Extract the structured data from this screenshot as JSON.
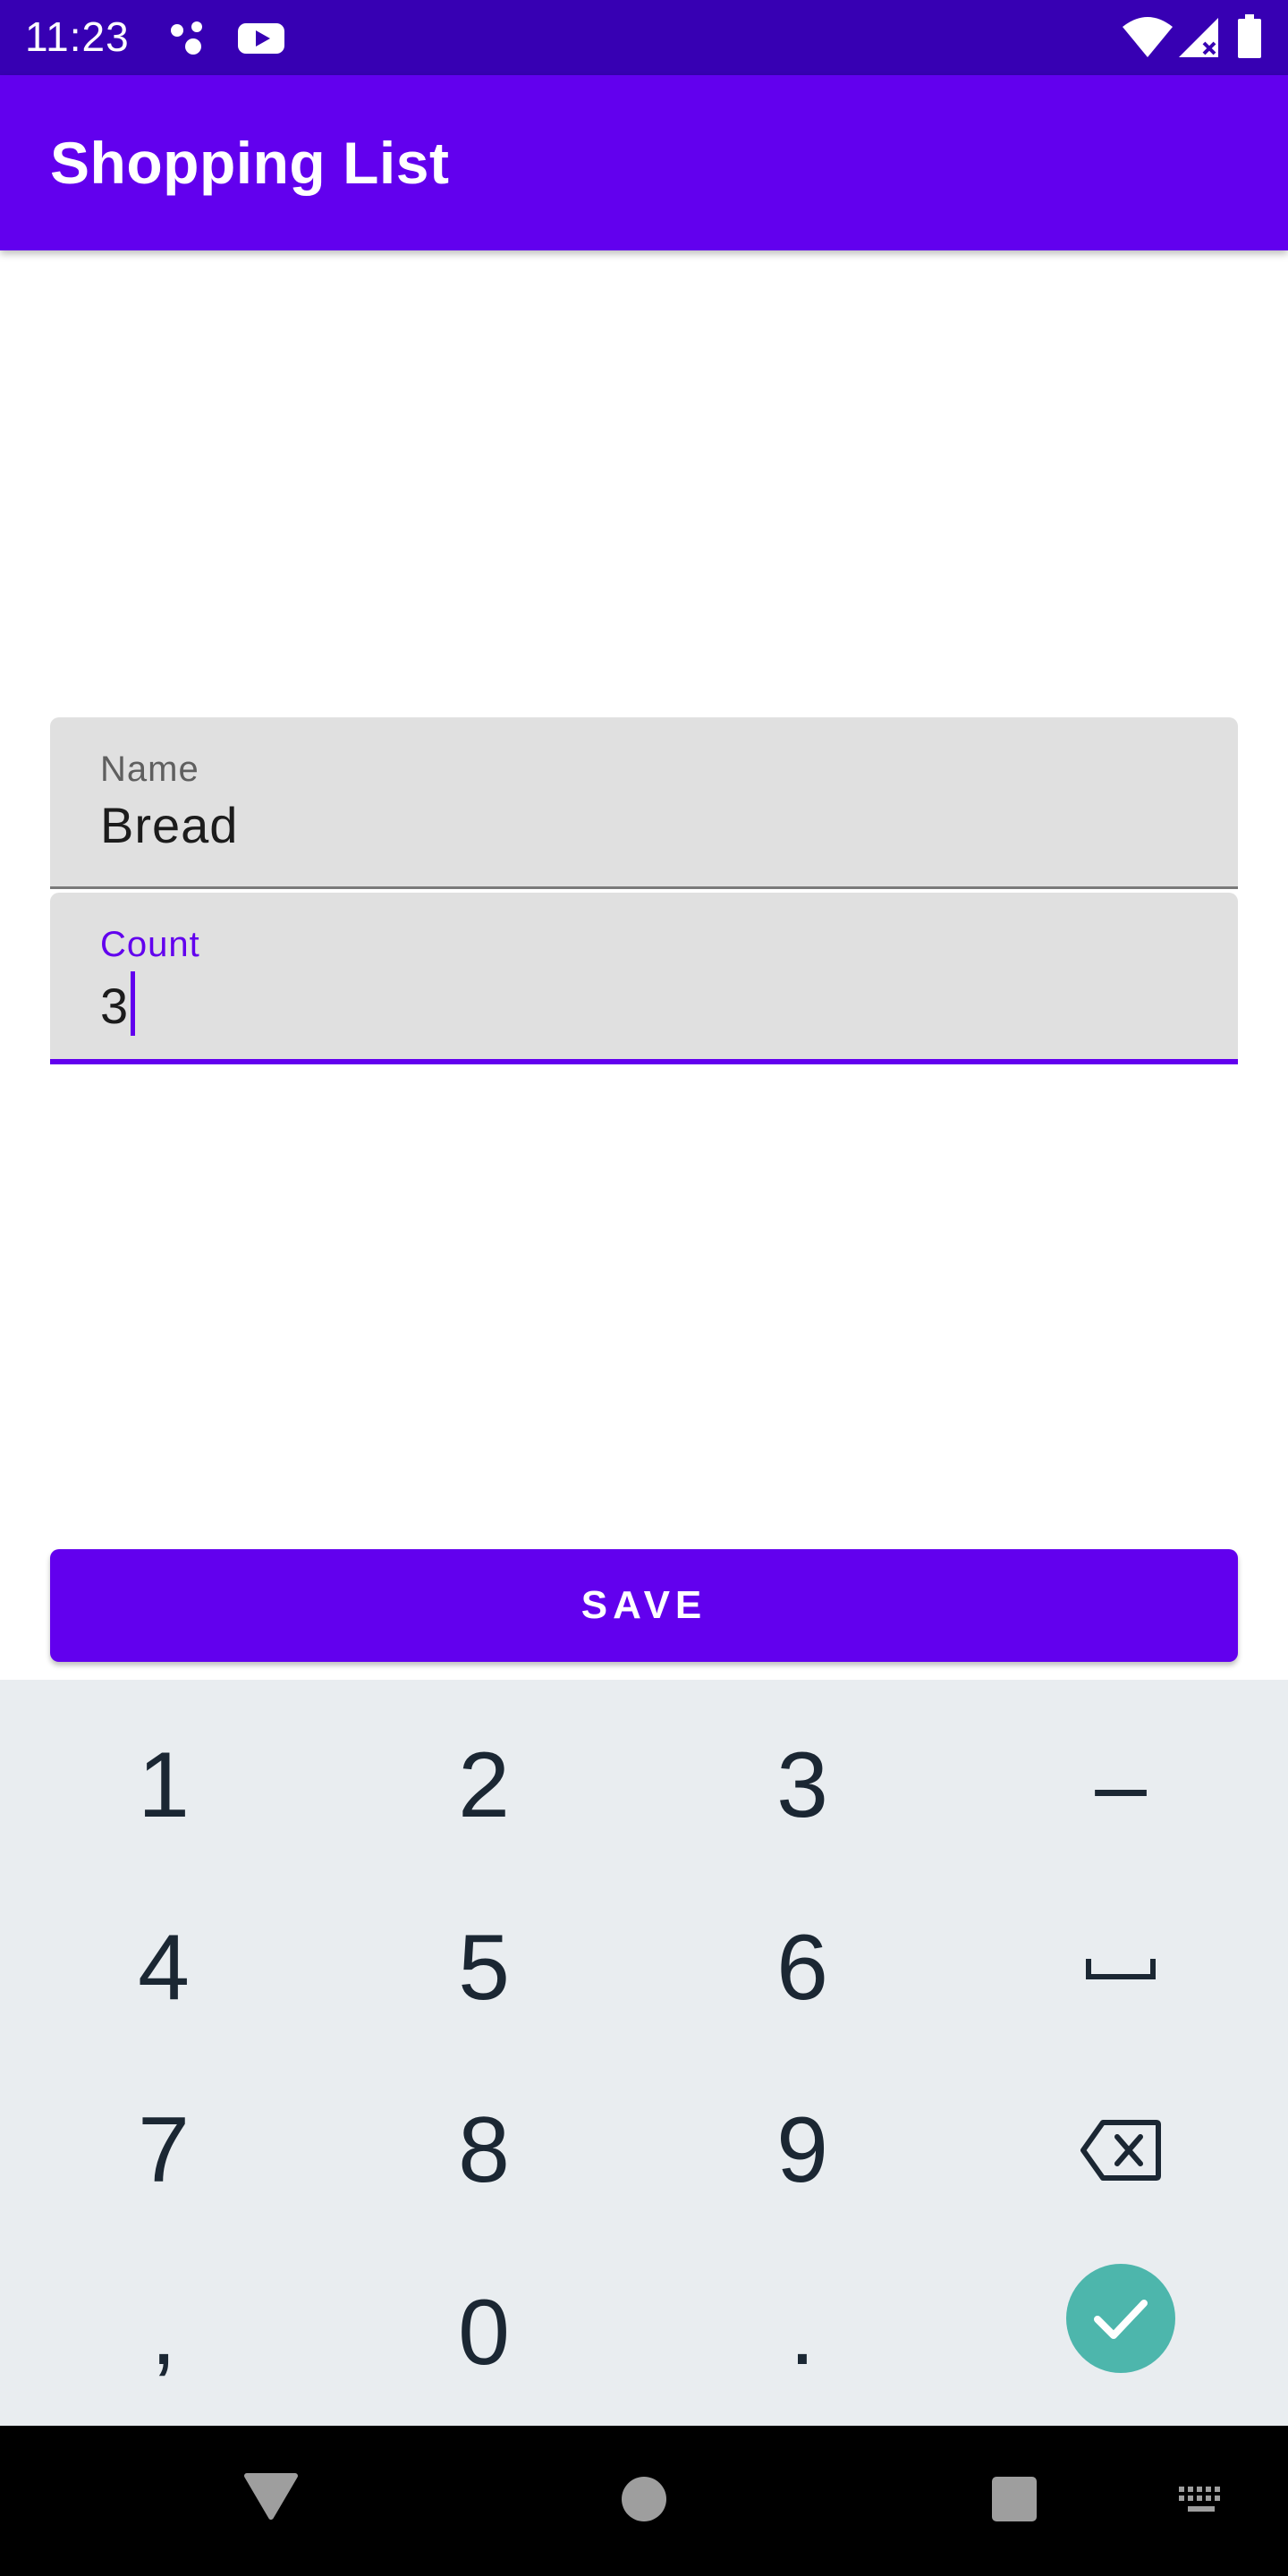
{
  "status_bar": {
    "time": "11:23",
    "icons": [
      "assistant-dots-icon",
      "youtube-icon",
      "wifi-icon",
      "signal-icon",
      "battery-icon"
    ]
  },
  "app_bar": {
    "title": "Shopping List"
  },
  "form": {
    "name_field": {
      "label": "Name",
      "value": "Bread"
    },
    "count_field": {
      "label": "Count",
      "value": "3",
      "focused": true
    }
  },
  "save_button": {
    "label": "SAVE"
  },
  "keyboard": {
    "rows": [
      [
        "1",
        "2",
        "3",
        "–"
      ],
      [
        "4",
        "5",
        "6",
        "space"
      ],
      [
        "7",
        "8",
        "9",
        "backspace"
      ],
      [
        ",",
        "0",
        ".",
        "done"
      ]
    ]
  },
  "nav_bar": {
    "icons": [
      "back-icon",
      "home-icon",
      "recents-icon",
      "keyboard-switch-icon"
    ]
  },
  "colors": {
    "status_bar": "#3700b3",
    "primary": "#6200ee",
    "field_background": "#e0e0e0",
    "keyboard_background": "#e9edf0",
    "done_key": "#4db6ac",
    "nav_bar": "#000000"
  }
}
